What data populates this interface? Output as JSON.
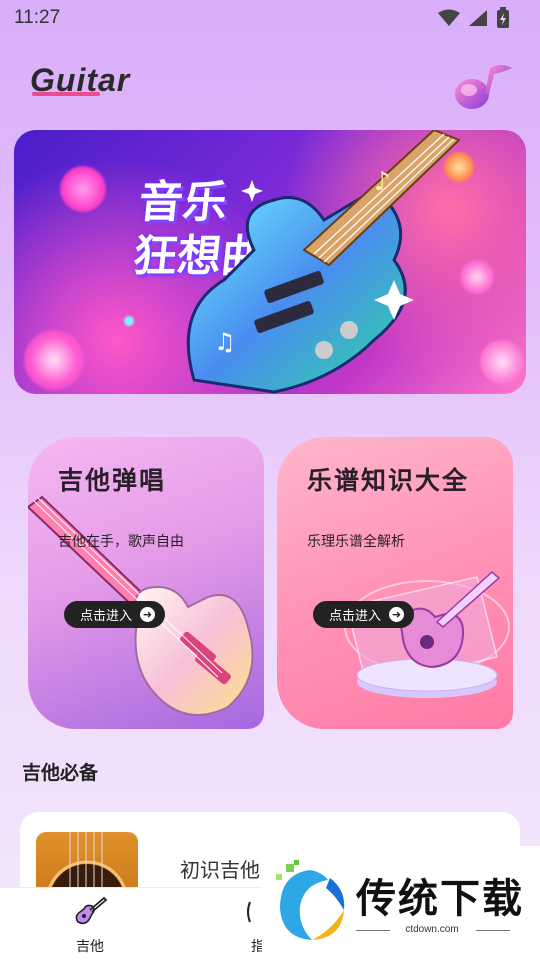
{
  "status_bar": {
    "time": "11:27",
    "icons": [
      "wifi-icon",
      "signal-icon",
      "battery-charging-icon"
    ]
  },
  "header": {
    "logo": "Guitar",
    "music_button_icon": "music-note-icon"
  },
  "banner": {
    "title_line1": "音乐",
    "title_line2": "狂想曲"
  },
  "cards": [
    {
      "title": "吉他弹唱",
      "subtitle": "吉他在手，歌声自由",
      "button": "点击进入"
    },
    {
      "title": "乐谱知识大全",
      "subtitle": "乐理乐谱全解析",
      "button": "点击进入"
    }
  ],
  "section": {
    "title": "吉他必备",
    "items": [
      {
        "title": "初识吉他"
      }
    ]
  },
  "tab_bar": {
    "tabs": [
      {
        "label": "吉他",
        "icon": "guitar-icon",
        "active": true
      },
      {
        "label": "指",
        "icon": "tuner-icon",
        "active": false
      }
    ]
  },
  "watermark": {
    "text": "传统下载",
    "url": "ctdown.com"
  },
  "colors": {
    "accent_pink": "#ee4a8f",
    "card_left": "#e49ae8",
    "card_right": "#ff93b6",
    "button_dark": "#222222"
  }
}
